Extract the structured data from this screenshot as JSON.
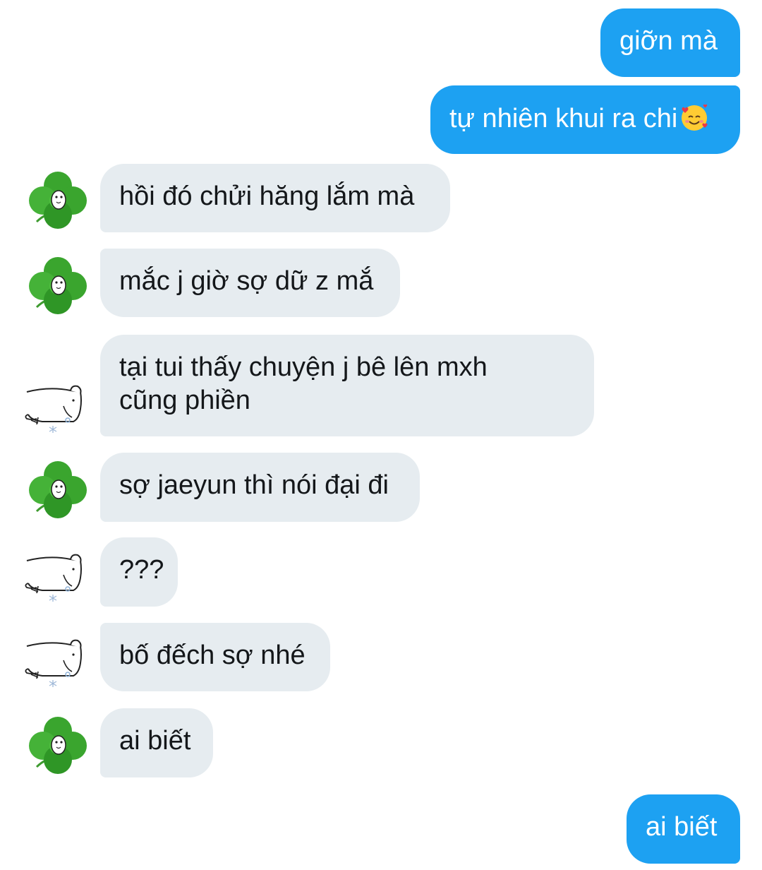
{
  "messages": [
    {
      "id": "m1",
      "side": "outgoing",
      "text": "giỡn mà"
    },
    {
      "id": "m2",
      "side": "outgoing",
      "text": "tự nhiên khui ra chi",
      "emoji": "smiling-face-with-hearts-emoji"
    },
    {
      "id": "m3",
      "side": "incoming",
      "avatar": "clover-avatar",
      "text": "hồi đó chửi hăng lắm mà"
    },
    {
      "id": "m4",
      "side": "incoming",
      "avatar": "clover-avatar",
      "text": "mắc j giờ sợ dữ z mắ"
    },
    {
      "id": "m5",
      "side": "incoming",
      "avatar": "sketch-bear-avatar",
      "line1": "tại tui thấy chuyện j bê lên mxh",
      "line2": "cũng phiền"
    },
    {
      "id": "m6",
      "side": "incoming",
      "avatar": "clover-avatar",
      "text": "sợ jaeyun thì nói đại đi"
    },
    {
      "id": "m7",
      "side": "incoming",
      "avatar": "sketch-bear-avatar",
      "text": "???"
    },
    {
      "id": "m8",
      "side": "incoming",
      "avatar": "sketch-bear-avatar",
      "text": "bố đếch sợ nhé"
    },
    {
      "id": "m9",
      "side": "incoming",
      "avatar": "clover-avatar",
      "text": "ai biết"
    },
    {
      "id": "m10",
      "side": "outgoing",
      "text": "ai biết"
    }
  ],
  "colors": {
    "outgoing_bubble": "#1da1f2",
    "incoming_bubble": "#e6ecf0",
    "outgoing_text": "#ffffff",
    "incoming_text": "#14171a",
    "clover_green": "#3aa52e"
  }
}
